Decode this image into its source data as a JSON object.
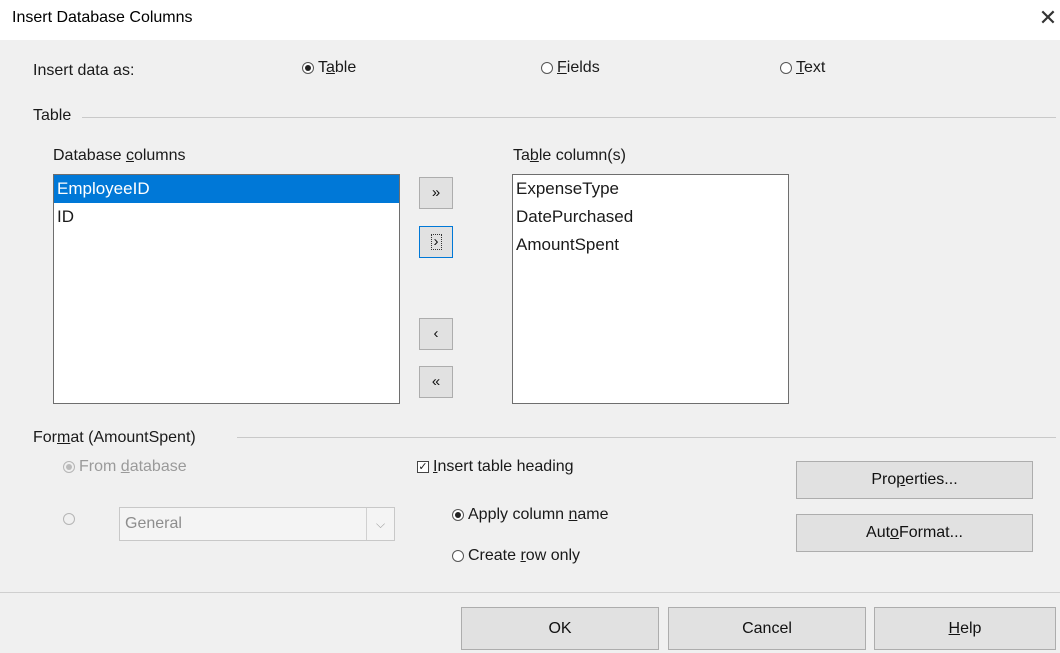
{
  "window": {
    "title": "Insert Database Columns",
    "close_glyph": "✕"
  },
  "insert_as": {
    "label": "Insert data as:",
    "options": [
      {
        "pre": "T",
        "key": "a",
        "post": "ble",
        "checked": true
      },
      {
        "pre": "",
        "key": "F",
        "post": "ields",
        "checked": false
      },
      {
        "pre": "",
        "key": "T",
        "post": "ext",
        "checked": false
      }
    ]
  },
  "table_section": {
    "label": "Table",
    "db_columns": {
      "label_pre": "Database ",
      "label_key": "c",
      "label_post": "olumns",
      "items": [
        "EmployeeID",
        "ID"
      ],
      "selected_index": 0
    },
    "table_columns": {
      "label_pre": "Ta",
      "label_key": "b",
      "label_post": "le column(s)",
      "items": [
        "ExpenseType",
        "DatePurchased",
        "AmountSpent"
      ]
    },
    "buttons": {
      "add_all": "»",
      "add_one": "›",
      "remove_one": "‹",
      "remove_all": "«"
    }
  },
  "format_section": {
    "label_pre": "For",
    "label_key": "m",
    "label_post": "at (AmountSpent)",
    "from_db": {
      "pre": "From ",
      "key": "d",
      "post": "atabase",
      "checked": true,
      "enabled": false
    },
    "custom_radio": {
      "checked": false,
      "enabled": false
    },
    "format_select": {
      "value": "General",
      "arrow": "⌵"
    },
    "insert_heading": {
      "pre": "",
      "key": "I",
      "post": "nsert table heading",
      "checked": true,
      "check_glyph": "✓"
    },
    "apply_column_name": {
      "pre": "Apply column ",
      "key": "n",
      "post": "ame",
      "checked": true
    },
    "create_row_only": {
      "pre": "Create ",
      "key": "r",
      "post": "ow only",
      "checked": false
    },
    "properties_button": {
      "pre": "Pro",
      "key": "p",
      "post": "erties..."
    },
    "autoformat_button": {
      "pre": "Aut",
      "key": "o",
      "post": "Format..."
    }
  },
  "footer": {
    "ok": "OK",
    "cancel": "Cancel",
    "help_key": "H",
    "help_post": "elp"
  }
}
